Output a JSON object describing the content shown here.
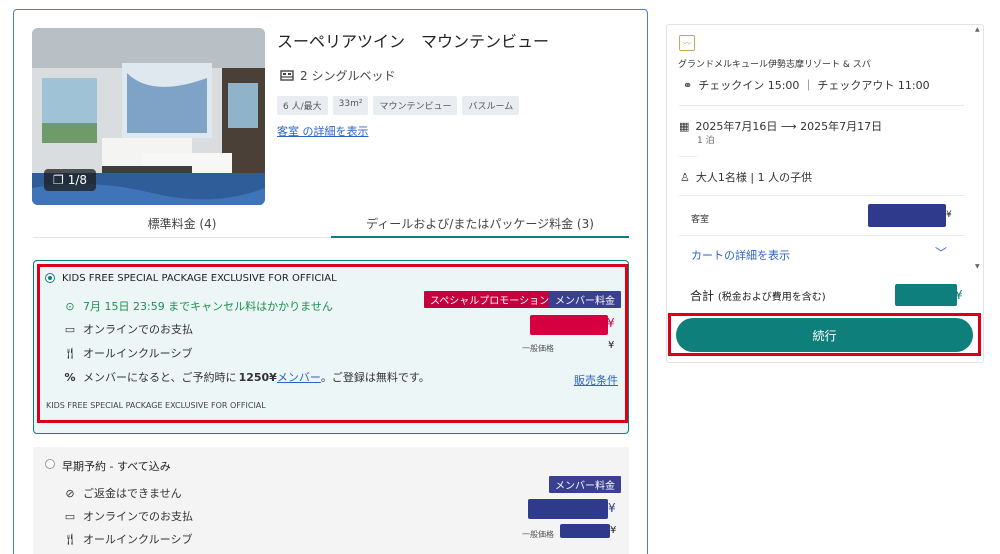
{
  "room": {
    "photo_count": "1/8",
    "title": "スーペリアツイン　マウンテンビュー",
    "beds": "2 シングルベッド",
    "tags": [
      "6 人/最大",
      "33m²",
      "マウンテンビュー",
      "バスルーム"
    ],
    "details_link": "客室 の詳細を表示"
  },
  "tabs": {
    "standard": "標準料金 (4)",
    "deal": "ディールおよび/またはパッケージ料金 (3)"
  },
  "rate1": {
    "title": "KIDS FREE SPECIAL PACKAGE EXCLUSIVE FOR OFFICIAL",
    "cancel": "7月 15日 23:59 までキャンセル料はかかりません",
    "payment": "オンラインでのお支払",
    "meal": "オールインクルーシブ",
    "member_prefix": "メンバーになると、ご予約時に",
    "member_amount": "1250¥",
    "member_link": "メンバー",
    "member_suffix": "。ご登録は無料です。",
    "badge_promo": "スペシャルプロモーション",
    "badge_member": "メンバー料金",
    "yen": "¥",
    "regular_label": "一般価格",
    "regular_yen": "¥",
    "conditions_link": "販売条件",
    "footer": "KIDS FREE SPECIAL PACKAGE EXCLUSIVE FOR OFFICIAL"
  },
  "rate2": {
    "title": "早期予約 - すべて込み",
    "refund": "ご返金はできません",
    "payment": "オンラインでのお支払",
    "meal": "オールインクルーシブ",
    "badge_member": "メンバー料金",
    "yen": "¥",
    "regular_label": "一般価格",
    "regular_yen": "¥"
  },
  "summary": {
    "hotel_name": "グランドメルキュール伊勢志摩リゾート & スパ",
    "checkin": "チェックイン 15:00 ｜ チェックアウト 11:00",
    "dates": "2025年7月16日 ⟶ 2025年7月17日",
    "nights": "1 泊",
    "guests": "大人1名様 | 1 人の子供",
    "room_label": "客室",
    "room_yen": "¥",
    "cart_link": "カートの詳細を表示",
    "total_label": "合計",
    "total_note": "(税金および費用を含む)",
    "total_yen": "¥",
    "continue": "続行"
  },
  "colors": {
    "accent": "#0e7f7a",
    "promo": "#c4003e",
    "member": "#3a3f8f",
    "highlight": "#d9001b",
    "link": "#2b63c6"
  }
}
